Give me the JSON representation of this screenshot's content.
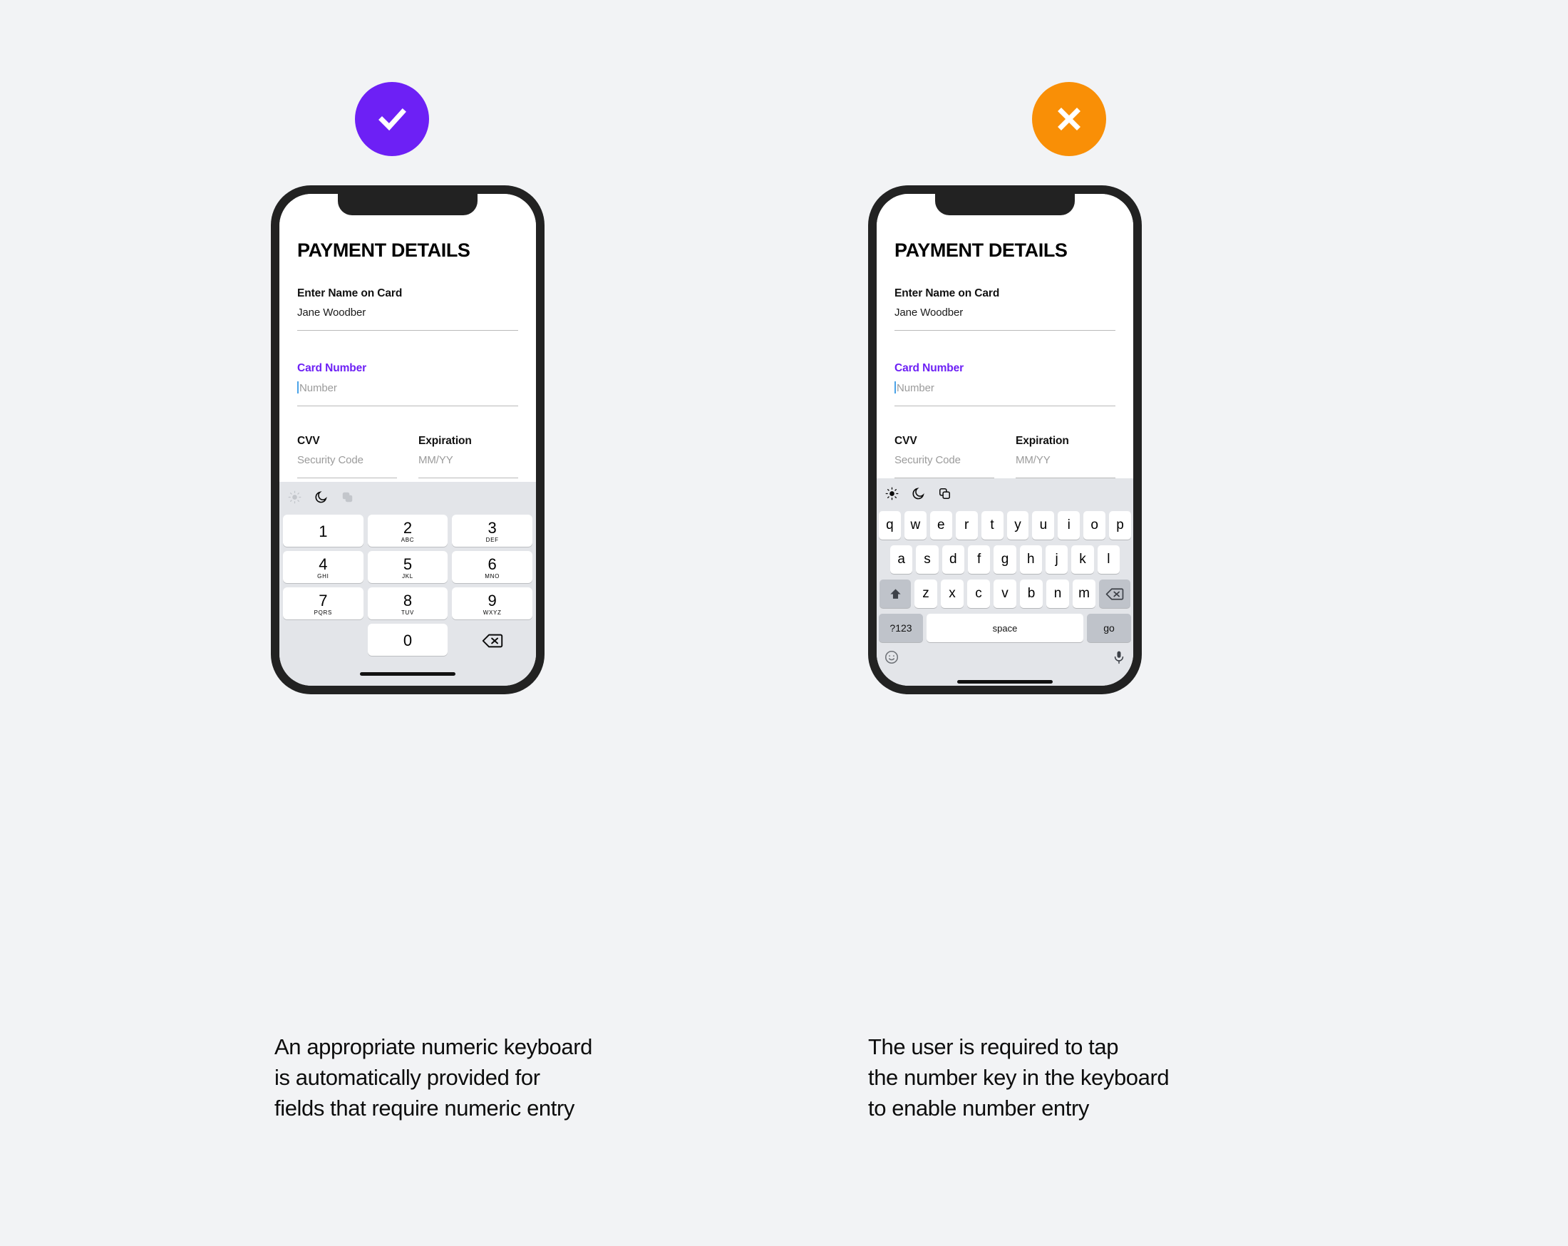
{
  "canvas": {
    "background": "#f2f3f5"
  },
  "colors": {
    "accent_purple": "#6d20f5",
    "error_orange": "#f98f06",
    "caret_blue": "#4aa3e8",
    "keyboard_bg": "#e3e5e9",
    "key_white": "#ffffff",
    "key_gray": "#bfc3ca",
    "phone_frame": "#222222"
  },
  "panels": [
    {
      "id": "good",
      "badge": {
        "icon": "checkmark-icon",
        "type": "success",
        "color": "#6d20f5"
      },
      "form": {
        "title": "PAYMENT DETAILS",
        "fields": [
          {
            "label": "Enter Name on Card",
            "value": "Jane Woodber",
            "placeholder": "",
            "is_placeholder": false,
            "accent": false,
            "caret": false
          },
          {
            "label": "Card Number",
            "value": "Number",
            "placeholder": "Number",
            "is_placeholder": true,
            "accent": true,
            "caret": true
          },
          {
            "label": "CVV",
            "value": "Security Code",
            "placeholder": "Security Code",
            "is_placeholder": true,
            "accent": false,
            "caret": false
          },
          {
            "label": "Expiration",
            "value": "MM/YY",
            "placeholder": "MM/YY",
            "is_placeholder": true,
            "accent": false,
            "caret": false
          }
        ]
      },
      "keyboard": {
        "type": "numeric",
        "toolbar": [
          {
            "icon": "sun-icon",
            "state": "inactive"
          },
          {
            "icon": "moon-icon",
            "state": "active"
          },
          {
            "icon": "copy-icon",
            "state": "inactive"
          }
        ],
        "rows": [
          [
            {
              "digit": "1",
              "letters": ""
            },
            {
              "digit": "2",
              "letters": "ABC"
            },
            {
              "digit": "3",
              "letters": "DEF"
            }
          ],
          [
            {
              "digit": "4",
              "letters": "GHI"
            },
            {
              "digit": "5",
              "letters": "JKL"
            },
            {
              "digit": "6",
              "letters": "MNO"
            }
          ],
          [
            {
              "digit": "7",
              "letters": "PQRS"
            },
            {
              "digit": "8",
              "letters": "TUV"
            },
            {
              "digit": "9",
              "letters": "WXYZ"
            }
          ],
          [
            {
              "digit": "",
              "letters": "",
              "kind": "blank"
            },
            {
              "digit": "0",
              "letters": ""
            },
            {
              "digit": "",
              "letters": "",
              "kind": "backspace",
              "icon": "backspace-icon"
            }
          ]
        ]
      },
      "caption": "An appropriate numeric keyboard\nis automatically provided for\nfields that require numeric entry"
    },
    {
      "id": "bad",
      "badge": {
        "icon": "close-x-icon",
        "type": "error",
        "color": "#f98f06"
      },
      "form": {
        "title": "PAYMENT DETAILS",
        "fields": [
          {
            "label": "Enter Name on Card",
            "value": "Jane Woodber",
            "placeholder": "",
            "is_placeholder": false,
            "accent": false,
            "caret": false
          },
          {
            "label": "Card Number",
            "value": "Number",
            "placeholder": "Number",
            "is_placeholder": true,
            "accent": true,
            "caret": true
          },
          {
            "label": "CVV",
            "value": "Security Code",
            "placeholder": "Security Code",
            "is_placeholder": true,
            "accent": false,
            "caret": false
          },
          {
            "label": "Expiration",
            "value": "MM/YY",
            "placeholder": "MM/YY",
            "is_placeholder": true,
            "accent": false,
            "caret": false
          }
        ]
      },
      "keyboard": {
        "type": "qwerty",
        "toolbar": [
          {
            "icon": "sun-icon",
            "state": "active"
          },
          {
            "icon": "moon-icon",
            "state": "active"
          },
          {
            "icon": "copy-icon",
            "state": "active"
          }
        ],
        "row1": [
          "q",
          "w",
          "e",
          "r",
          "t",
          "y",
          "u",
          "i",
          "o",
          "p"
        ],
        "row2": [
          "a",
          "s",
          "d",
          "f",
          "g",
          "h",
          "j",
          "k",
          "l"
        ],
        "row3": [
          "z",
          "x",
          "c",
          "v",
          "b",
          "n",
          "m"
        ],
        "shift_icon": "shift-up-arrow-icon",
        "backspace_icon": "backspace-icon",
        "bottom": {
          "numeric_toggle": "?123",
          "space": "space",
          "enter": "go"
        },
        "emoji_icon": "emoji-smiley-icon",
        "mic_icon": "microphone-icon"
      },
      "caption": "The user is required to tap\nthe number key in the keyboard\nto enable number entry"
    }
  ]
}
